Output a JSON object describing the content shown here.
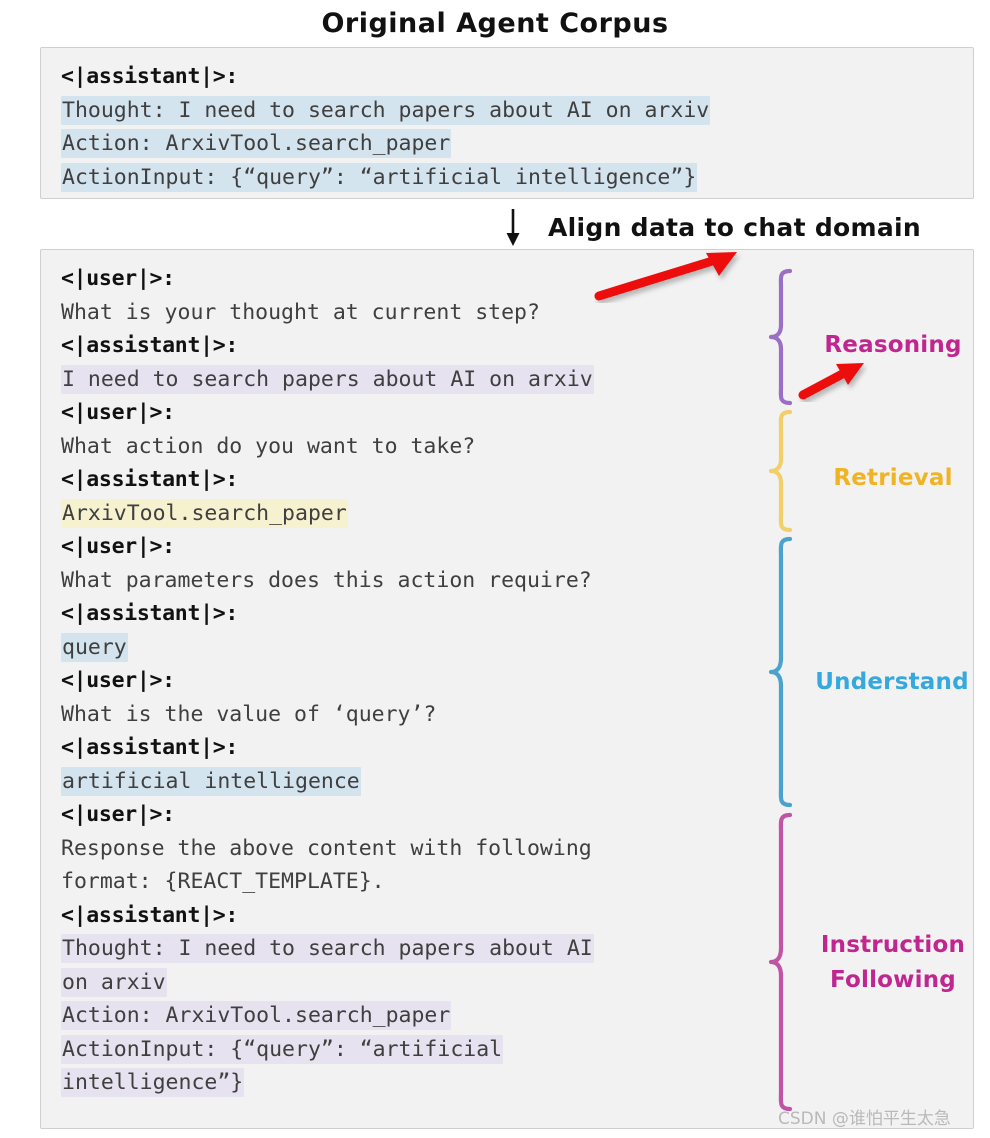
{
  "figure": {
    "title": "Original Agent Corpus",
    "flow_caption": "Align data to chat domain",
    "watermark": "CSDN @谁怕平生太急"
  },
  "colors": {
    "highlight_blue": "#d4e4ee",
    "highlight_purple": "#e6e2ef",
    "highlight_yellow": "#f6f2cf",
    "reasoning": "#c0268f",
    "retrieval": "#f0b323",
    "understand": "#35a8dd",
    "instruction": "#c0268f",
    "brace_reasoning": "#9a6fc4",
    "brace_retrieval": "#f2cf6a",
    "brace_understand": "#4ba3cc",
    "brace_instruction": "#c054a5",
    "arrow_red": "#ee1111",
    "panel_background": "#f2f2f2",
    "panel_border": "#cfcfcf"
  },
  "original_panel": {
    "lines": [
      {
        "text": "<|assistant|>:",
        "role": true,
        "highlight": "none"
      },
      {
        "text": "Thought: I need to search papers about AI on arxiv",
        "role": false,
        "highlight": "blue"
      },
      {
        "text": "Action: ArxivTool.search_paper",
        "role": false,
        "highlight": "blue"
      },
      {
        "text": "ActionInput: {“query”: “artificial intelligence”}",
        "role": false,
        "highlight": "blue"
      }
    ]
  },
  "aligned_panel": {
    "lines": [
      {
        "text": "<|user|>:",
        "role": true,
        "highlight": "none"
      },
      {
        "text": "What is your thought at current step?",
        "role": false,
        "highlight": "none"
      },
      {
        "text": "<|assistant|>:",
        "role": true,
        "highlight": "none"
      },
      {
        "text": "I need to search papers about AI on arxiv",
        "role": false,
        "highlight": "purple"
      },
      {
        "text": "<|user|>:",
        "role": true,
        "highlight": "none"
      },
      {
        "text": "What action do you want to take?",
        "role": false,
        "highlight": "none"
      },
      {
        "text": "<|assistant|>:",
        "role": true,
        "highlight": "none"
      },
      {
        "text": "ArxivTool.search_paper",
        "role": false,
        "highlight": "yellow"
      },
      {
        "text": "<|user|>:",
        "role": true,
        "highlight": "none"
      },
      {
        "text": "What parameters does this action require?",
        "role": false,
        "highlight": "none"
      },
      {
        "text": "<|assistant|>:",
        "role": true,
        "highlight": "none"
      },
      {
        "text": "query",
        "role": false,
        "highlight": "blue"
      },
      {
        "text": "<|user|>:",
        "role": true,
        "highlight": "none"
      },
      {
        "text": "What is the value of ‘query’?",
        "role": false,
        "highlight": "none"
      },
      {
        "text": "<|assistant|>:",
        "role": true,
        "highlight": "none"
      },
      {
        "text": "artificial intelligence",
        "role": false,
        "highlight": "blue"
      },
      {
        "text": "<|user|>:",
        "role": true,
        "highlight": "none"
      },
      {
        "text": "Response the above content with following",
        "role": false,
        "highlight": "none"
      },
      {
        "text": "format: {REACT_TEMPLATE}.",
        "role": false,
        "highlight": "none"
      },
      {
        "text": "<|assistant|>:",
        "role": true,
        "highlight": "none"
      },
      {
        "text": "Thought: I need to search papers about AI",
        "role": false,
        "highlight": "purple"
      },
      {
        "text": "on arxiv",
        "role": false,
        "highlight": "purple"
      },
      {
        "text": "Action: ArxivTool.search_paper",
        "role": false,
        "highlight": "purple"
      },
      {
        "text": "ActionInput: {“query”: “artificial",
        "role": false,
        "highlight": "purple"
      },
      {
        "text": "intelligence”}",
        "role": false,
        "highlight": "purple"
      }
    ]
  },
  "groups": [
    {
      "label": "Reasoning",
      "color": "#c0268f"
    },
    {
      "label": "Retrieval",
      "color": "#f0b323"
    },
    {
      "label": "Understand",
      "color": "#35a8dd"
    },
    {
      "label": "Instruction\nFollowing",
      "label_line1": "Instruction",
      "label_line2": "Following",
      "color": "#c0268f"
    }
  ]
}
